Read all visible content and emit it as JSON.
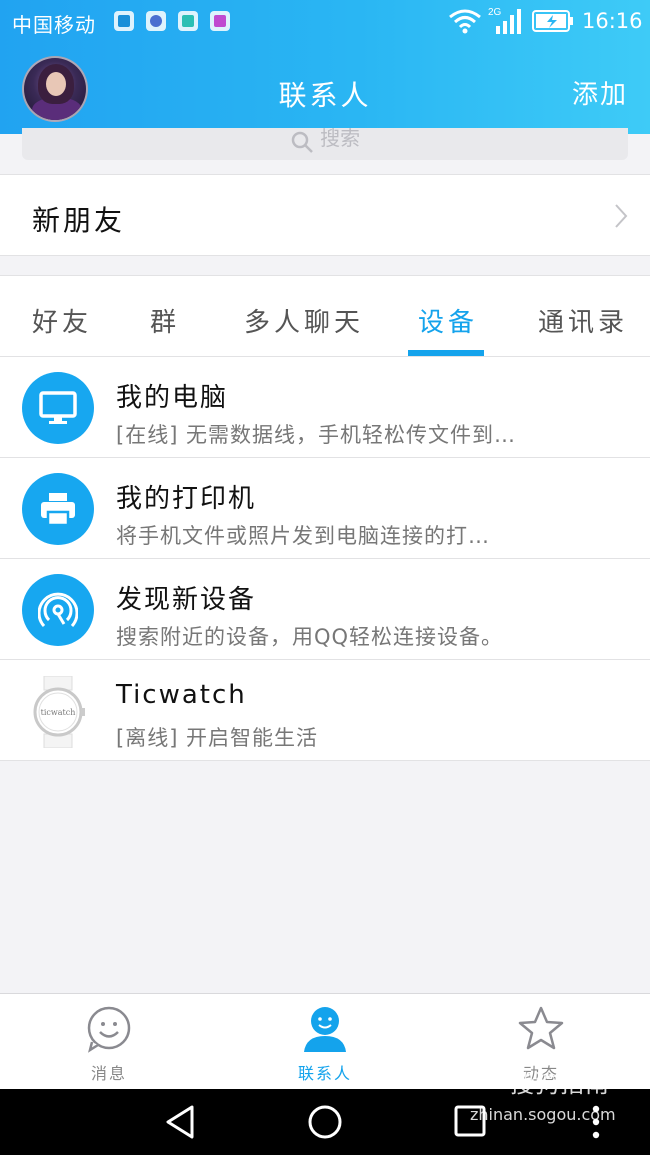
{
  "status_bar": {
    "carrier": "中国移动",
    "network": "2G",
    "time": "16:16"
  },
  "header": {
    "title": "联系人",
    "add_label": "添加"
  },
  "search": {
    "placeholder": "搜索"
  },
  "new_friends": {
    "label": "新朋友"
  },
  "tabs": [
    {
      "label": "好友"
    },
    {
      "label": "群"
    },
    {
      "label": "多人聊天"
    },
    {
      "label": "设备",
      "active": true
    },
    {
      "label": "通讯录"
    }
  ],
  "devices": [
    {
      "name": "我的电脑",
      "desc": "[在线] 无需数据线，手机轻松传文件到…",
      "icon": "monitor-icon"
    },
    {
      "name": "我的打印机",
      "desc": "将手机文件或照片发到电脑连接的打…",
      "icon": "printer-icon"
    },
    {
      "name": "发现新设备",
      "desc": "搜索附近的设备，用QQ轻松连接设备。",
      "icon": "radar-icon"
    },
    {
      "name": "Ticwatch",
      "desc": "[离线] 开启智能生活",
      "icon": "watch-icon",
      "watch_text": "ticwatch"
    }
  ],
  "bottom_nav": [
    {
      "label": "消息",
      "icon": "smiley-icon"
    },
    {
      "label": "联系人",
      "icon": "contact-icon",
      "active": true
    },
    {
      "label": "动态",
      "icon": "star-icon"
    }
  ],
  "watermark": {
    "brand": "搜狗指南",
    "url": "zhinan.sogou.com"
  },
  "colors": {
    "accent": "#14a3ec",
    "header_gradient_start": "#21a3f1",
    "header_gradient_end": "#3ecbf7"
  }
}
